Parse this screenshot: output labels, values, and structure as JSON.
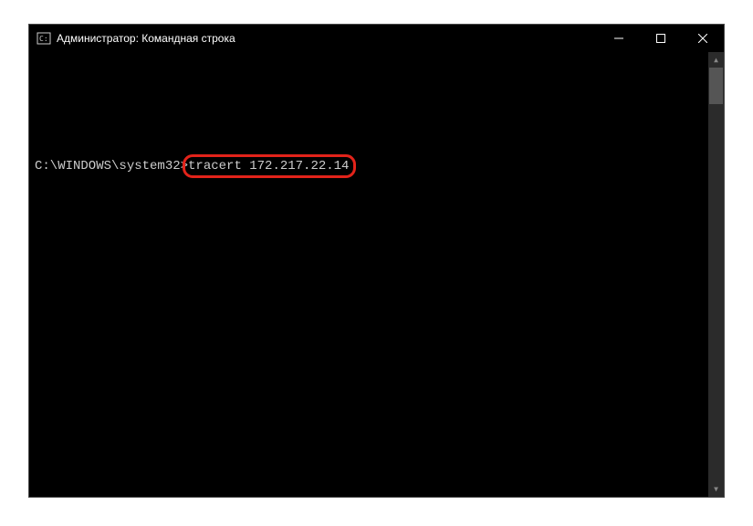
{
  "titlebar": {
    "title": "Администратор: Командная строка"
  },
  "terminal": {
    "prompt": "C:\\WINDOWS\\system32>",
    "command": "tracert 172.217.22.14"
  }
}
